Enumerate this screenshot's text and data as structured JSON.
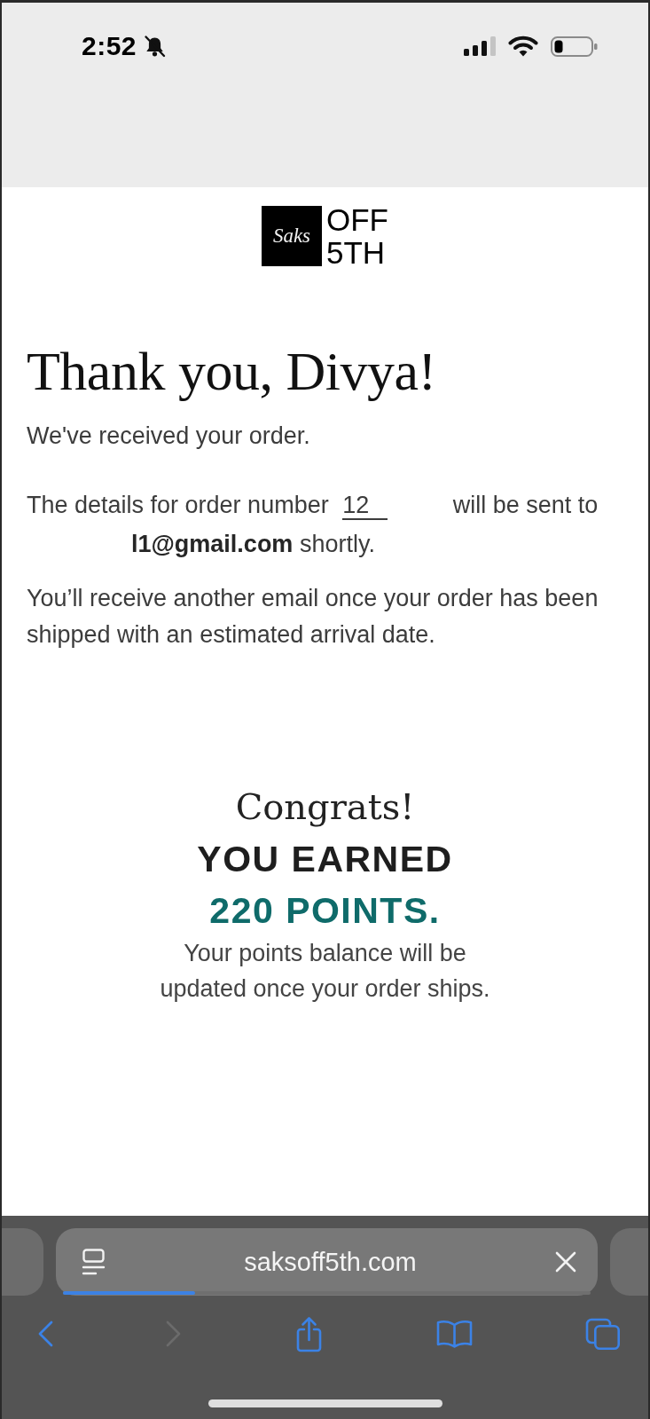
{
  "status_bar": {
    "time": "2:52"
  },
  "logo": {
    "mark": "Saks",
    "wordmark_lines": [
      "OFF",
      "5TH"
    ]
  },
  "confirmation": {
    "title": "Thank you, Divya!",
    "received": "We've received your order.",
    "details": {
      "text_before_number": "The details for order number",
      "order_number": "12",
      "text_after_number": "will be sent to",
      "email_line": "**l1@gmail.com** shortly."
    },
    "shipping_note": "You’ll receive another email once your order has been shipped with an estimated arrival date."
  },
  "rewards": {
    "heading": "Congrats!",
    "earned": "YOU EARNED",
    "points": "220 POINTS.",
    "note": "Your points balance will be updated once your order ships."
  },
  "browser": {
    "url": "saksoff5th.com",
    "page_load": {
      "level": 0.25
    },
    "toolbar": [
      {
        "kind": "back",
        "disabled": false
      },
      {
        "kind": "forward",
        "disabled": true
      },
      {
        "kind": "share",
        "disabled": false
      },
      {
        "kind": "bookmarks",
        "disabled": false
      },
      {
        "kind": "tabs",
        "disabled": false
      }
    ]
  }
}
